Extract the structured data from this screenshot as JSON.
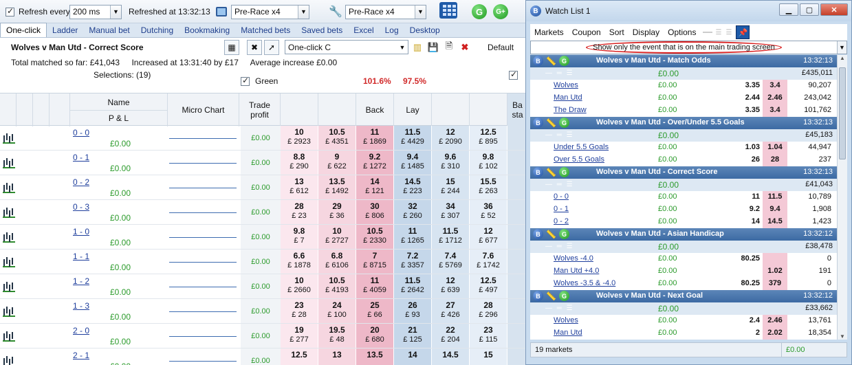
{
  "toolbar": {
    "refresh_label": "Refresh every",
    "refresh_value": "200 ms",
    "refreshed_at": "Refreshed at 13:32:13",
    "profile1": "Pre-Race x4",
    "profile2": "Pre-Race x4",
    "g_label": "G",
    "gplus_label": "G+"
  },
  "tabs": [
    "One-click",
    "Ladder",
    "Manual bet",
    "Dutching",
    "Bookmaking",
    "Matched bets",
    "Saved bets",
    "Excel",
    "Log",
    "Desktop"
  ],
  "header": {
    "market_title": "Wolves v Man Utd - Correct Score",
    "oneclick_value": "One-click C",
    "default_label": "Default",
    "total_matched": "Total matched so far: £41,043",
    "increased": "Increased at 13:31:40 by £17",
    "avg_increase": "Average increase £0.00",
    "selections": "Selections: (19)",
    "green_label": "Green",
    "back_pct": "101.6%",
    "lay_pct": "97.5%"
  },
  "columns": {
    "name": "Name",
    "pl": "P & L",
    "micro_chart": "Micro Chart",
    "trade_profit_1": "Trade",
    "trade_profit_2": "profit",
    "back": "Back",
    "lay": "Lay",
    "right_1": "Ba",
    "right_2": "sta"
  },
  "rows": [
    {
      "name": "0 - 0",
      "pl": "£0.00",
      "trade": "£0.00",
      "prices": [
        [
          "10",
          "£ 2923"
        ],
        [
          "10.5",
          "£ 4351"
        ],
        [
          "11",
          "£ 1869"
        ],
        [
          "11.5",
          "£ 4429"
        ],
        [
          "12",
          "£ 2090"
        ],
        [
          "12.5",
          "£ 895"
        ]
      ]
    },
    {
      "name": "0 - 1",
      "pl": "£0.00",
      "trade": "£0.00",
      "prices": [
        [
          "8.8",
          "£ 290"
        ],
        [
          "9",
          "£ 622"
        ],
        [
          "9.2",
          "£ 1272"
        ],
        [
          "9.4",
          "£ 1485"
        ],
        [
          "9.6",
          "£ 310"
        ],
        [
          "9.8",
          "£ 102"
        ]
      ]
    },
    {
      "name": "0 - 2",
      "pl": "£0.00",
      "trade": "£0.00",
      "prices": [
        [
          "13",
          "£ 612"
        ],
        [
          "13.5",
          "£ 1492"
        ],
        [
          "14",
          "£ 121"
        ],
        [
          "14.5",
          "£ 223"
        ],
        [
          "15",
          "£ 244"
        ],
        [
          "15.5",
          "£ 263"
        ]
      ]
    },
    {
      "name": "0 - 3",
      "pl": "£0.00",
      "trade": "£0.00",
      "prices": [
        [
          "28",
          "£ 23"
        ],
        [
          "29",
          "£ 36"
        ],
        [
          "30",
          "£ 806"
        ],
        [
          "32",
          "£ 260"
        ],
        [
          "34",
          "£ 307"
        ],
        [
          "36",
          "£ 52"
        ]
      ]
    },
    {
      "name": "1 - 0",
      "pl": "£0.00",
      "trade": "£0.00",
      "prices": [
        [
          "9.8",
          "£ 7"
        ],
        [
          "10",
          "£ 2727"
        ],
        [
          "10.5",
          "£ 2330"
        ],
        [
          "11",
          "£ 1265"
        ],
        [
          "11.5",
          "£ 1712"
        ],
        [
          "12",
          "£ 677"
        ]
      ]
    },
    {
      "name": "1 - 1",
      "pl": "£0.00",
      "trade": "£0.00",
      "prices": [
        [
          "6.6",
          "£ 1878"
        ],
        [
          "6.8",
          "£ 6106"
        ],
        [
          "7",
          "£ 8715"
        ],
        [
          "7.2",
          "£ 3357"
        ],
        [
          "7.4",
          "£ 5769"
        ],
        [
          "7.6",
          "£ 1742"
        ]
      ]
    },
    {
      "name": "1 - 2",
      "pl": "£0.00",
      "trade": "£0.00",
      "prices": [
        [
          "10",
          "£ 2660"
        ],
        [
          "10.5",
          "£ 4193"
        ],
        [
          "11",
          "£ 4059"
        ],
        [
          "11.5",
          "£ 2642"
        ],
        [
          "12",
          "£ 639"
        ],
        [
          "12.5",
          "£ 497"
        ]
      ]
    },
    {
      "name": "1 - 3",
      "pl": "£0.00",
      "trade": "£0.00",
      "prices": [
        [
          "23",
          "£ 28"
        ],
        [
          "24",
          "£ 100"
        ],
        [
          "25",
          "£ 66"
        ],
        [
          "26",
          "£ 93"
        ],
        [
          "27",
          "£ 426"
        ],
        [
          "28",
          "£ 296"
        ]
      ]
    },
    {
      "name": "2 - 0",
      "pl": "£0.00",
      "trade": "£0.00",
      "prices": [
        [
          "19",
          "£ 277"
        ],
        [
          "19.5",
          "£ 48"
        ],
        [
          "20",
          "£ 680"
        ],
        [
          "21",
          "£ 125"
        ],
        [
          "22",
          "£ 204"
        ],
        [
          "23",
          "£ 115"
        ]
      ]
    },
    {
      "name": "2 - 1",
      "pl": "£0.00",
      "trade": "£0.00",
      "prices": [
        [
          "12.5",
          ""
        ],
        [
          "13",
          ""
        ],
        [
          "13.5",
          ""
        ],
        [
          "14",
          ""
        ],
        [
          "14.5",
          ""
        ],
        [
          "15",
          ""
        ]
      ]
    }
  ],
  "watch": {
    "title": "Watch List 1",
    "menu": [
      "Markets",
      "Coupon",
      "Sort",
      "Display",
      "Options"
    ],
    "combo_text": "Show only the event that is on the main trading screen",
    "status_count": "19 markets",
    "status_total": "£0.00",
    "markets": [
      {
        "title": "Wolves v Man Utd - Match Odds",
        "time": "13:32:13",
        "pl": "£0.00",
        "matched": "£435,011",
        "selections": [
          {
            "name": "Wolves",
            "pl": "£0.00",
            "back": "3.35",
            "lay": "3.4",
            "vol": "90,207"
          },
          {
            "name": "Man Utd",
            "pl": "£0.00",
            "back": "2.44",
            "lay": "2.46",
            "vol": "243,042"
          },
          {
            "name": "The Draw",
            "pl": "£0.00",
            "back": "3.35",
            "lay": "3.4",
            "vol": "101,762"
          }
        ]
      },
      {
        "title": "Wolves v Man Utd - Over/Under 5.5 Goals",
        "time": "13:32:13",
        "pl": "£0.00",
        "matched": "£45,183",
        "selections": [
          {
            "name": "Under 5.5 Goals",
            "pl": "£0.00",
            "back": "1.03",
            "lay": "1.04",
            "vol": "44,947"
          },
          {
            "name": "Over 5.5 Goals",
            "pl": "£0.00",
            "back": "26",
            "lay": "28",
            "vol": "237"
          }
        ]
      },
      {
        "title": "Wolves v Man Utd - Correct Score",
        "time": "13:32:13",
        "pl": "£0.00",
        "matched": "£41,043",
        "selections": [
          {
            "name": "0 - 0",
            "pl": "£0.00",
            "back": "11",
            "lay": "11.5",
            "vol": "10,789"
          },
          {
            "name": "0 - 1",
            "pl": "£0.00",
            "back": "9.2",
            "lay": "9.4",
            "vol": "1,908"
          },
          {
            "name": "0 - 2",
            "pl": "£0.00",
            "back": "14",
            "lay": "14.5",
            "vol": "1,423"
          }
        ]
      },
      {
        "title": "Wolves v Man Utd - Asian Handicap",
        "time": "13:32:12",
        "pl": "£0.00",
        "matched": "£38,478",
        "selections": [
          {
            "name": "Wolves -4.0",
            "pl": "£0.00",
            "back": "80.25",
            "lay": "",
            "vol": "0"
          },
          {
            "name": "Man Utd +4.0",
            "pl": "£0.00",
            "back": "",
            "lay": "1.02",
            "vol": "191"
          },
          {
            "name": "Wolves -3.5 & -4.0",
            "pl": "£0.00",
            "back": "80.25",
            "lay": "379",
            "vol": "0"
          }
        ]
      },
      {
        "title": "Wolves v Man Utd - Next Goal",
        "time": "13:32:12",
        "pl": "£0.00",
        "matched": "£33,662",
        "selections": [
          {
            "name": "Wolves",
            "pl": "£0.00",
            "back": "2.4",
            "lay": "2.46",
            "vol": "13,761"
          },
          {
            "name": "Man Utd",
            "pl": "£0.00",
            "back": "2",
            "lay": "2.02",
            "vol": "18,354"
          }
        ]
      }
    ]
  }
}
